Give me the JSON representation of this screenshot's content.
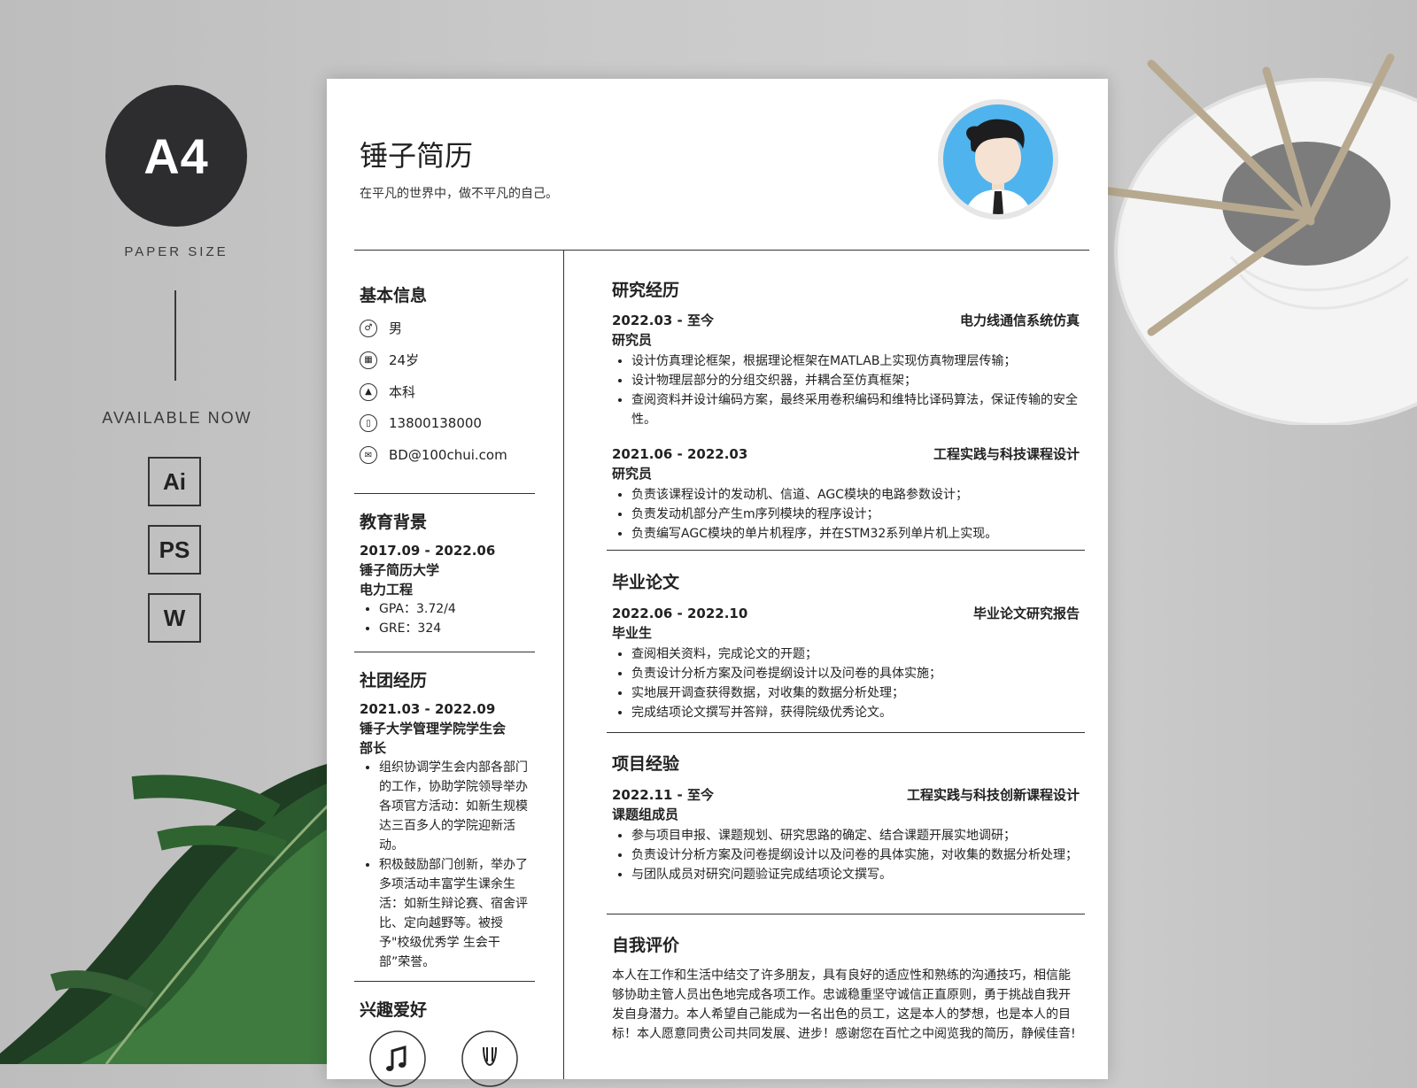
{
  "deco": {
    "a4": "A4",
    "paper_size": "PAPER SIZE",
    "available": "AVAILABLE NOW",
    "formats": [
      "Ai",
      "PS",
      "W"
    ]
  },
  "header": {
    "name": "锤子简历",
    "motto": "在平凡的世界中，做不平凡的自己。"
  },
  "basic": {
    "title": "基本信息",
    "items": [
      {
        "icon": "gender-icon",
        "text": "男"
      },
      {
        "icon": "calendar-icon",
        "text": "24岁"
      },
      {
        "icon": "graduation-cap-icon",
        "text": "本科"
      },
      {
        "icon": "phone-icon",
        "text": "13800138000"
      },
      {
        "icon": "mail-icon",
        "text": "BD@100chui.com"
      }
    ]
  },
  "education": {
    "title": "教育背景",
    "date": "2017.09 - 2022.06",
    "school": "锤子简历大学",
    "major": "电力工程",
    "bullets": [
      "GPA：3.72/4",
      "GRE：324"
    ]
  },
  "club": {
    "title": "社团经历",
    "date": "2021.03 - 2022.09",
    "org": "锤子大学管理学院学生会",
    "role": "部长",
    "bullets": [
      "组织协调学生会内部各部门的工作，协助学院领导举办各项官方活动：如新生规模达三百多人的学院迎新活动。",
      "积极鼓励部门创新，举办了多项活动丰富学生课余生活：如新生辩论赛、宿舍评比、定向越野等。被授予\"校级优秀学 生会干部”荣誉。"
    ]
  },
  "hobby": {
    "title": "兴趣爱好",
    "icons": [
      "music-icon",
      "dance-icon"
    ]
  },
  "research": {
    "title": "研究经历",
    "entries": [
      {
        "date": "2022.03 - 至今",
        "project": "电力线通信系统仿真",
        "role": "研究员",
        "bullets": [
          "设计仿真理论框架，根据理论框架在MATLAB上实现仿真物理层传输；",
          "设计物理层部分的分组交织器，并耦合至仿真框架；",
          "查阅资料并设计编码方案，最终采用卷积编码和维特比译码算法，保证传输的安全性。"
        ]
      },
      {
        "date": "2021.06 - 2022.03",
        "project": "工程实践与科技课程设计",
        "role": "研究员",
        "bullets": [
          "负责该课程设计的发动机、信道、AGC模块的电路参数设计；",
          "负责发动机部分产生m序列模块的程序设计；",
          "负责编写AGC模块的单片机程序，并在STM32系列单片机上实现。"
        ]
      }
    ]
  },
  "thesis": {
    "title": "毕业论文",
    "date": "2022.06 - 2022.10",
    "project": "毕业论文研究报告",
    "role": "毕业生",
    "bullets": [
      "查阅相关资料，完成论文的开题；",
      "负责设计分析方案及问卷提纲设计以及问卷的具体实施；",
      "实地展开调查获得数据，对收集的数据分析处理；",
      "完成结项论文撰写并答辩，获得院级优秀论文。"
    ]
  },
  "project": {
    "title": "项目经验",
    "date": "2022.11 - 至今",
    "project": "工程实践与科技创新课程设计",
    "role": "课题组成员",
    "bullets": [
      "参与项目申报、课题规划、研究思路的确定、结合课题开展实地调研；",
      "负责设计分析方案及问卷提纲设计以及问卷的具体实施，对收集的数据分析处理；",
      "与团队成员对研究问题验证完成结项论文撰写。"
    ]
  },
  "self": {
    "title": "自我评价",
    "text": "本人在工作和生活中结交了许多朋友，具有良好的适应性和熟练的沟通技巧，相信能够协助主管人员出色地完成各项工作。忠诚稳重坚守诚信正直原则，勇于挑战自我开发自身潜力。本人希望自己能成为一名出色的员工，这是本人的梦想，也是本人的目标！本人愿意同贵公司共同发展、进步！感谢您在百忙之中阅览我的简历，静候佳音!"
  }
}
